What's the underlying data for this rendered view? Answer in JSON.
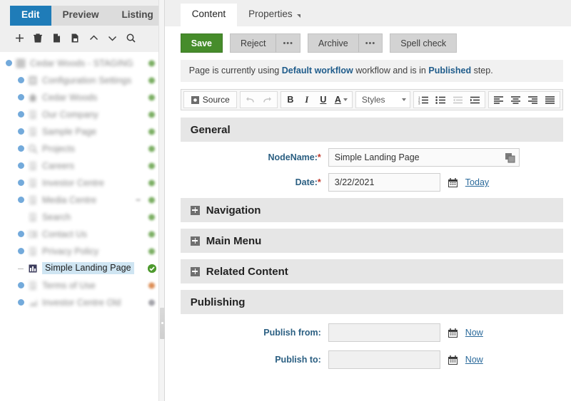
{
  "left_panel": {
    "view_tabs": [
      {
        "label": "Edit",
        "active": true
      },
      {
        "label": "Preview",
        "active": false
      },
      {
        "label": "Listing",
        "active": false
      }
    ],
    "toolbar_icons": [
      "plus-icon",
      "trash-icon",
      "copy-icon",
      "paste-icon",
      "chevron-up-icon",
      "chevron-down-icon",
      "search-icon"
    ],
    "tree": [
      {
        "label": "Cedar Woods - STAGING",
        "level": 0,
        "icon": "site-icon",
        "status": "green",
        "blurred": true,
        "expander": true
      },
      {
        "label": "Configuration Settings",
        "level": 1,
        "icon": "gear-page-icon",
        "status": "green",
        "blurred": true,
        "expander": true
      },
      {
        "label": "Cedar Woods",
        "level": 1,
        "icon": "home-icon",
        "status": "green",
        "blurred": true,
        "expander": true
      },
      {
        "label": "Our Company",
        "level": 1,
        "icon": "page-icon",
        "status": "green",
        "blurred": true,
        "expander": true
      },
      {
        "label": "Sample Page",
        "level": 1,
        "icon": "page-icon",
        "status": "green",
        "blurred": true,
        "expander": true
      },
      {
        "label": "Projects",
        "level": 1,
        "icon": "projects-icon",
        "status": "green",
        "blurred": true,
        "expander": true
      },
      {
        "label": "Careers",
        "level": 1,
        "icon": "page-icon",
        "status": "green",
        "blurred": true,
        "expander": true
      },
      {
        "label": "Investor Centre",
        "level": 1,
        "icon": "page-icon",
        "status": "green",
        "blurred": true,
        "expander": true
      },
      {
        "label": "Media Centre",
        "level": 1,
        "icon": "page-icon",
        "status": "green",
        "blurred": true,
        "expander": true,
        "trailing_mark": true
      },
      {
        "label": "Search",
        "level": 1,
        "icon": "page-icon",
        "status": "green",
        "blurred": true,
        "expander": false
      },
      {
        "label": "Contact Us",
        "level": 1,
        "icon": "contact-icon",
        "status": "green",
        "blurred": true,
        "expander": true
      },
      {
        "label": "Privacy Policy",
        "level": 1,
        "icon": "page-icon",
        "status": "green",
        "blurred": true,
        "expander": true
      },
      {
        "label": "Simple Landing Page",
        "level": 1,
        "icon": "landing-page-icon",
        "status": "check",
        "blurred": false,
        "expander": false,
        "selected": true
      },
      {
        "label": "Terms of Use",
        "level": 1,
        "icon": "page-icon",
        "status": "orange",
        "blurred": true,
        "expander": true
      },
      {
        "label": "Investor Centre Old",
        "level": 1,
        "icon": "chart-icon",
        "status": "grey",
        "blurred": true,
        "expander": true
      }
    ]
  },
  "content_tabs": [
    {
      "label": "Content",
      "active": true,
      "has_caret": false
    },
    {
      "label": "Properties",
      "active": false,
      "has_caret": true
    }
  ],
  "actions": {
    "save_label": "Save",
    "reject_label": "Reject",
    "reject_more": "•••",
    "archive_label": "Archive",
    "archive_more": "•••",
    "spell_check_label": "Spell check"
  },
  "workflow_message": {
    "prefix": "Page is currently using ",
    "workflow_name": "Default workflow",
    "middle": " workflow and is in ",
    "step_name": "Published",
    "suffix": " step."
  },
  "editor_toolbar": {
    "source_label": "Source",
    "undo_icon": "undo-icon",
    "redo_icon": "redo-icon",
    "bold_label": "B",
    "italic_label": "I",
    "underline_label": "U",
    "text_color_label": "A",
    "styles_label": "Styles",
    "numbered_list_icon": "numbered-list-icon",
    "bulleted_list_icon": "bulleted-list-icon",
    "outdent_icon": "outdent-icon",
    "indent_icon": "indent-icon",
    "align_left_icon": "align-left-icon",
    "align_center_icon": "align-center-icon",
    "align_right_icon": "align-right-icon",
    "align_justify_icon": "align-justify-icon"
  },
  "form": {
    "general": {
      "title": "General",
      "nodename_label": "NodeName:",
      "nodename_value": "Simple Landing Page",
      "date_label": "Date:",
      "date_value": "3/22/2021",
      "today_link": "Today",
      "required_mark": "*"
    },
    "collapsed_sections": [
      {
        "title": "Navigation"
      },
      {
        "title": "Main Menu"
      },
      {
        "title": "Related Content"
      }
    ],
    "publishing": {
      "title": "Publishing",
      "publish_from_label": "Publish from:",
      "publish_from_value": "",
      "publish_from_now": "Now",
      "publish_to_label": "Publish to:",
      "publish_to_value": "",
      "publish_to_now": "Now"
    }
  },
  "colors": {
    "accent_blue": "#1f7cb8",
    "save_green": "#468c2b",
    "status_green": "#5a9a3c",
    "status_orange": "#d4722c",
    "status_grey": "#8b8b93",
    "label_blue": "#2b5f82",
    "link_blue": "#2b6a9b",
    "selection_blue": "#cfe5f2"
  }
}
